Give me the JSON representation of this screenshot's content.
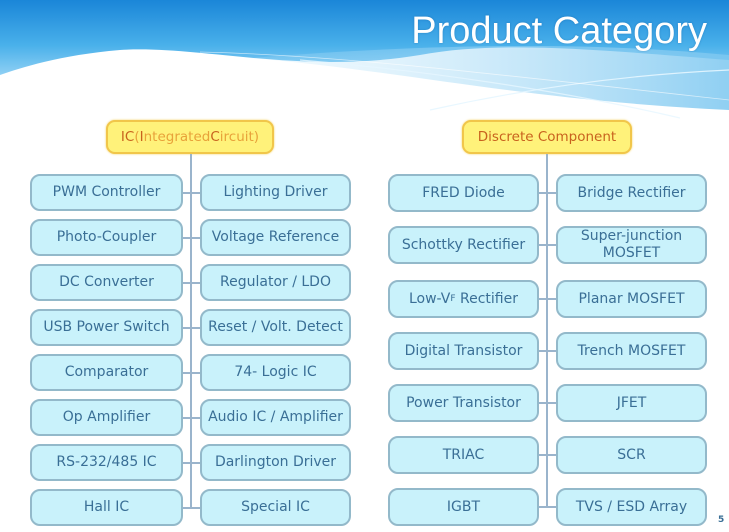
{
  "title": "Product Category",
  "page_number": "5",
  "colors": {
    "banner_blue": "#2a9be0",
    "header_fill": "#fff27a",
    "header_border": "#f1c64a",
    "node_fill": "#c9f2fb",
    "node_border": "#93b9ca",
    "node_text": "#3a6f96"
  },
  "ic": {
    "header": {
      "prefix_1": "IC",
      "paren_open": " (",
      "I": "I",
      "ntegrated": "ntegrated ",
      "C": "C",
      "ircuit": "ircuit",
      "paren_close": ")"
    },
    "left": [
      "PWM Controller",
      "Photo-Coupler",
      "DC Converter",
      "USB Power Switch",
      "Comparator",
      "Op Amplifier",
      "RS-232/485 IC",
      "Hall IC"
    ],
    "right": [
      "Lighting Driver",
      "Voltage Reference",
      "Regulator / LDO",
      "Reset / Volt. Detect",
      "74- Logic IC",
      "Audio IC / Amplifier",
      "Darlington Driver",
      "Special IC"
    ]
  },
  "discrete": {
    "header": "Discrete Component",
    "left": [
      "FRED Diode",
      "Schottky Rectifier",
      "Low-V",
      "Digital Transistor",
      "Power Transistor",
      "TRIAC",
      "IGBT"
    ],
    "left_low_vf": {
      "prefix": "Low-V",
      "sub": "F",
      "suffix": " Rectifier"
    },
    "right": [
      "Bridge Rectifier",
      "Super-junction MOSFET",
      "Planar MOSFET",
      "Trench MOSFET",
      "JFET",
      "SCR",
      "TVS / ESD Array"
    ],
    "right_superjunction": {
      "line1": "Super-junction",
      "line2": "MOSFET"
    }
  }
}
